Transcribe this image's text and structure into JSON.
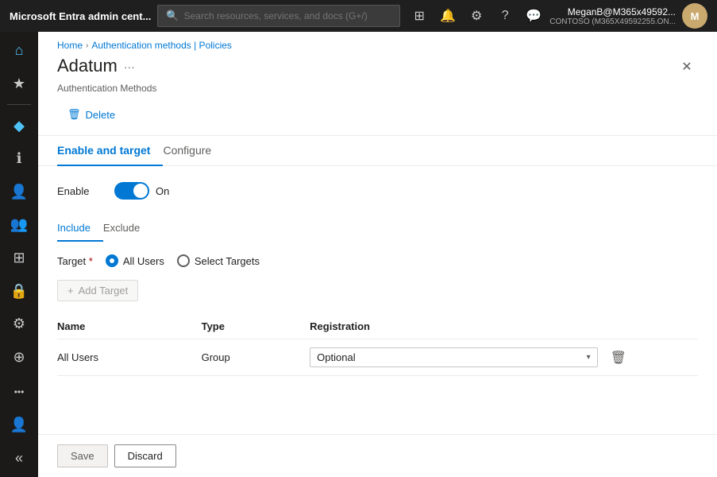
{
  "topbar": {
    "app_name": "Microsoft Entra admin cent...",
    "search_placeholder": "Search resources, services, and docs (G+/)",
    "user_name": "MeganB@M365x49592...",
    "user_tenant": "CONTOSO (M365X49592255.ON...",
    "user_initials": "M"
  },
  "sidebar": {
    "items": [
      {
        "icon": "⌂",
        "name": "home"
      },
      {
        "icon": "★",
        "name": "favorites"
      },
      {
        "icon": "—",
        "name": "divider1"
      },
      {
        "icon": "◆",
        "name": "identity"
      },
      {
        "icon": "ℹ",
        "name": "info"
      },
      {
        "icon": "👤",
        "name": "users"
      },
      {
        "icon": "👥",
        "name": "groups"
      },
      {
        "icon": "⊞",
        "name": "apps"
      },
      {
        "icon": "🔒",
        "name": "protection"
      },
      {
        "icon": "⚙",
        "name": "settings"
      },
      {
        "icon": "⊕",
        "name": "workload"
      }
    ],
    "bottom_items": [
      {
        "icon": "•••",
        "name": "more"
      },
      {
        "icon": "👤",
        "name": "profile"
      },
      {
        "icon": "«",
        "name": "collapse"
      }
    ]
  },
  "breadcrumb": {
    "items": [
      {
        "label": "Home",
        "active": false
      },
      {
        "label": "Authentication methods | Policies",
        "active": false
      },
      {
        "label": "",
        "active": true
      }
    ]
  },
  "panel": {
    "title": "Adatum",
    "subtitle": "Authentication Methods",
    "more_label": "···",
    "close_label": "✕",
    "delete_btn_label": "Delete",
    "tabs": [
      {
        "label": "Enable and target",
        "active": true
      },
      {
        "label": "Configure",
        "active": false
      }
    ],
    "enable_label": "Enable",
    "toggle_state": "On",
    "sub_tabs": [
      {
        "label": "Include",
        "active": true
      },
      {
        "label": "Exclude",
        "active": false
      }
    ],
    "target_label": "Target",
    "target_required": "*",
    "radio_options": [
      {
        "label": "All Users",
        "selected": true
      },
      {
        "label": "Select Targets",
        "selected": false
      }
    ],
    "add_target_label": "Add Target",
    "table": {
      "columns": [
        {
          "label": "Name"
        },
        {
          "label": "Type"
        },
        {
          "label": "Registration"
        }
      ],
      "rows": [
        {
          "name": "All Users",
          "type": "Group",
          "registration": "Optional"
        }
      ]
    },
    "save_label": "Save",
    "discard_label": "Discard"
  }
}
